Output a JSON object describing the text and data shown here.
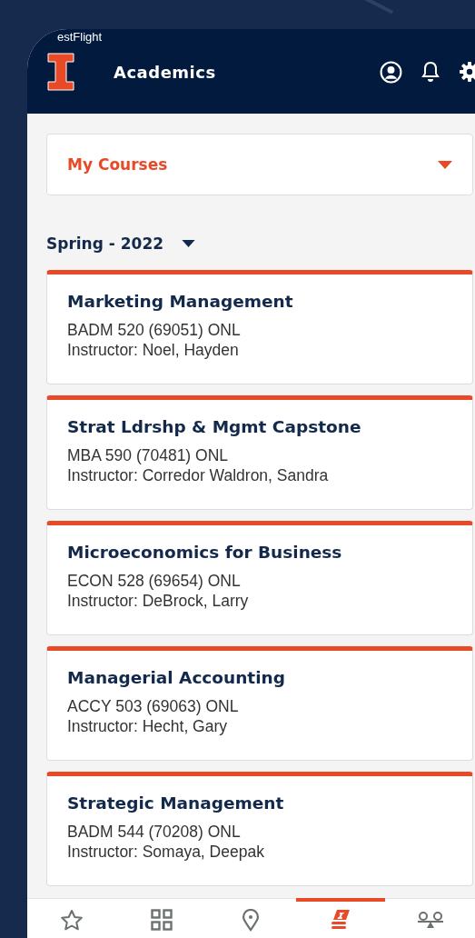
{
  "status_bar": {
    "back_label": "estFlight"
  },
  "header": {
    "title": "Academics"
  },
  "dropdown": {
    "label": "My Courses"
  },
  "term": {
    "label": "Spring - 2022"
  },
  "courses": [
    {
      "title": "Marketing Management",
      "code": "BADM 520 (69051) ONL",
      "instructor": "Instructor: Noel, Hayden"
    },
    {
      "title": "Strat Ldrshp & Mgmt Capstone",
      "code": "MBA 590 (70481) ONL",
      "instructor": "Instructor: Corredor Waldron, Sandra"
    },
    {
      "title": "Microeconomics for Business",
      "code": "ECON 528 (69654) ONL",
      "instructor": "Instructor: DeBrock, Larry"
    },
    {
      "title": "Managerial Accounting",
      "code": "ACCY 503 (69063) ONL",
      "instructor": "Instructor: Hecht, Gary"
    },
    {
      "title": "Strategic Management",
      "code": "BADM 544 (70208) ONL",
      "instructor": "Instructor: Somaya, Deepak"
    }
  ],
  "tab_bar": [
    {
      "kind": "favorites",
      "selected": false
    },
    {
      "kind": "browse",
      "selected": false
    },
    {
      "kind": "map",
      "selected": false
    },
    {
      "kind": "academics",
      "selected": true
    },
    {
      "kind": "wellness",
      "selected": false
    }
  ]
}
